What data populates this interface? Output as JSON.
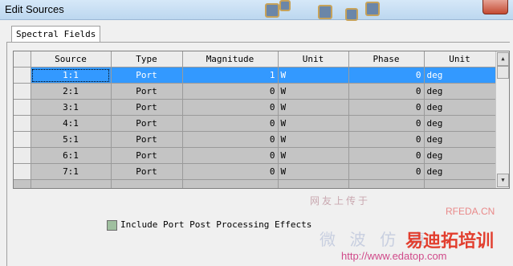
{
  "window": {
    "title": "Edit Sources"
  },
  "tabs": [
    {
      "label": "Spectral Fields"
    }
  ],
  "table": {
    "columns": [
      "Source",
      "Type",
      "Magnitude",
      "Unit",
      "Phase",
      "Unit"
    ],
    "rows": [
      [
        "1:1",
        "Port",
        "1",
        "W",
        "0",
        "deg"
      ],
      [
        "2:1",
        "Port",
        "0",
        "W",
        "0",
        "deg"
      ],
      [
        "3:1",
        "Port",
        "0",
        "W",
        "0",
        "deg"
      ],
      [
        "4:1",
        "Port",
        "0",
        "W",
        "0",
        "deg"
      ],
      [
        "5:1",
        "Port",
        "0",
        "W",
        "0",
        "deg"
      ],
      [
        "6:1",
        "Port",
        "0",
        "W",
        "0",
        "deg"
      ],
      [
        "7:1",
        "Port",
        "0",
        "W",
        "0",
        "deg"
      ]
    ],
    "selected_row": 0
  },
  "options": {
    "include_port_post_processing_label": "Include Port Post Processing Effects",
    "include_port_post_processing_checked": false
  },
  "watermark": {
    "line1": "网友上传于",
    "line2": "RFEDA.CN",
    "line3": "微 波 仿 真",
    "brand": "易迪拓培训",
    "url": "http://www.edatop.com"
  }
}
